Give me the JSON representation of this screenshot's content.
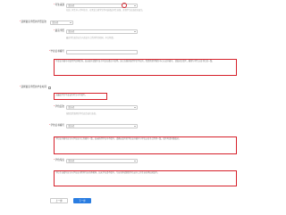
{
  "form": {
    "field1": {
      "label": "考生来源",
      "value": "请选择",
      "hint": "在高三考生中入学时在京、在黑龙江省学生等可选择此考生来源，其他学生应选择应届生。"
    },
    "field2": {
      "label": "选择最高学历的学历层次",
      "value": "请选择"
    },
    "field3": {
      "label": "最高学历",
      "value": "请选择",
      "hint": "最高学历层次应当与您证书上所列学历相同，中文称谓。"
    },
    "field4": {
      "label": "毕业证书编号",
      "value": "",
      "note": "毕业证书编号可使用学信网查询，如无编号请填写证书号后在备注中说明。如已在国外取得学历学位的，需提供留学服务中心认证书编号，请核对后填写，确保与学历认证书信息一致。"
    },
    "field5": {
      "label": "选择最高学历的毕业时间",
      "note": "无最高学历毕业证的考生可不填写。"
    },
    "field6": {
      "label": "学位层次",
      "value": "请选择",
      "hint": "按照您所取得的学位层次进行选择。"
    },
    "field7": {
      "label": "学位证书编号",
      "value": "请选择",
      "note": "学位证书编号应当与学位证书上的编号一致，如未获得学位可不填写。请确认填写的学位证书编号与学位认证书上所列一致，填写时请仔细核对。"
    },
    "field8": {
      "label": "学位专业",
      "value": "请选择",
      "note": "学位专业填写应当与学位证书所列专业名称相同，如无学位请不填写。专业名称请参照学位证书上的专业名称如实填写。"
    },
    "buttons": {
      "prev": "上一步",
      "next": "下一步"
    }
  },
  "colors": {
    "accent": "#2a7de1",
    "highlight": "#d6202a"
  }
}
